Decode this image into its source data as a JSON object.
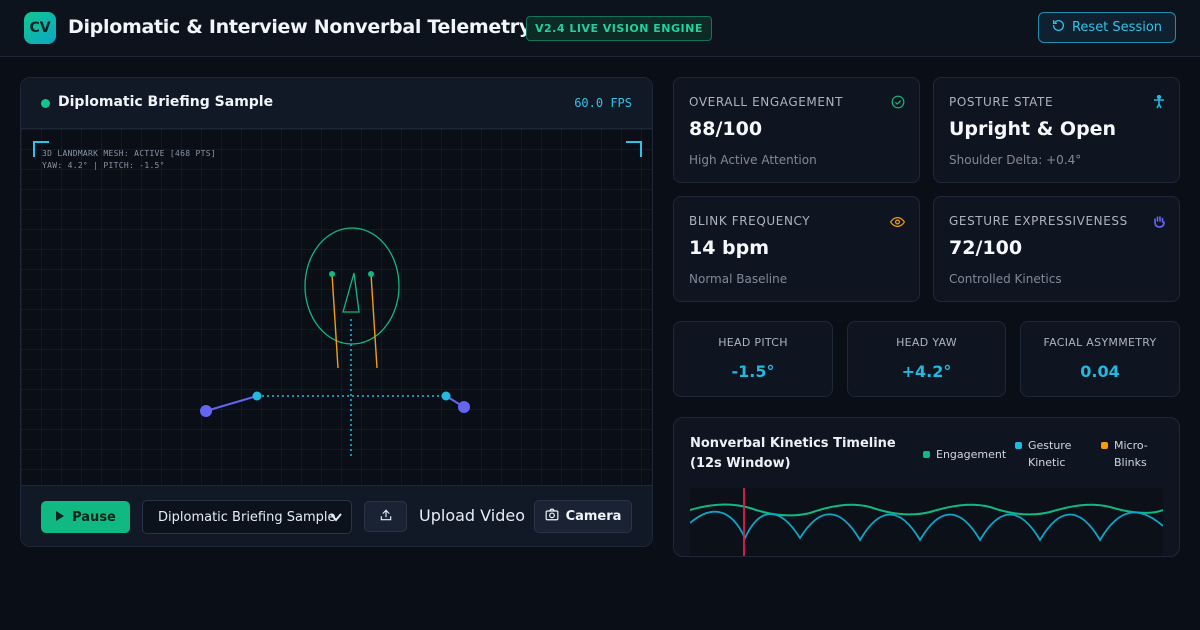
{
  "header": {
    "logo": "CV",
    "title": "Diplomatic & Interview Nonverbal Telemetry Analyzer",
    "badge": "V2.4 LIVE VISION ENGINE",
    "reset_label": "Reset Session"
  },
  "video": {
    "title": "Diplomatic Briefing Sample",
    "fps": "60.0 FPS",
    "overlay_line1": "3D LANDMARK MESH: ACTIVE [468 PTS]",
    "overlay_line2": "YAW: 4.2° | PITCH: -1.5°",
    "controls": {
      "pause_label": "Pause",
      "source_selected": "Diplomatic Briefing Sample",
      "upload_label": "Upload Video",
      "camera_label": "Camera"
    }
  },
  "metrics": {
    "engagement": {
      "label": "OVERALL ENGAGEMENT",
      "value": "88/100",
      "sub": "High Active Attention"
    },
    "posture": {
      "label": "POSTURE STATE",
      "value": "Upright & Open",
      "sub": "Shoulder Delta: +0.4°"
    },
    "blink": {
      "label": "BLINK FREQUENCY",
      "value": "14 bpm",
      "sub": "Normal Baseline"
    },
    "gesture": {
      "label": "GESTURE EXPRESSIVENESS",
      "value": "72/100",
      "sub": "Controlled Kinetics"
    }
  },
  "mini": {
    "pitch": {
      "label": "HEAD PITCH",
      "value": "-1.5°"
    },
    "yaw": {
      "label": "HEAD YAW",
      "value": "+4.2°"
    },
    "asym": {
      "label": "FACIAL ASYMMETRY",
      "value": "0.04"
    }
  },
  "timeline": {
    "title": "Nonverbal Kinetics Timeline (12s Window)",
    "legend": [
      "Engagement",
      "Gesture Kinetic",
      "Micro-Blinks"
    ]
  },
  "colors": {
    "accent_green": "#10b981",
    "accent_cyan": "#22b8e0",
    "accent_amber": "#f59e0b",
    "accent_indigo": "#6366f1",
    "playhead_red": "#e11d48"
  },
  "icons": {
    "reset": "rotate-ccw-icon",
    "engagement": "check-circle-icon",
    "posture": "person-standing-icon",
    "blink": "eye-icon",
    "gesture": "hand-icon",
    "upload": "upload-icon",
    "camera": "camera-icon",
    "play": "play-icon"
  }
}
